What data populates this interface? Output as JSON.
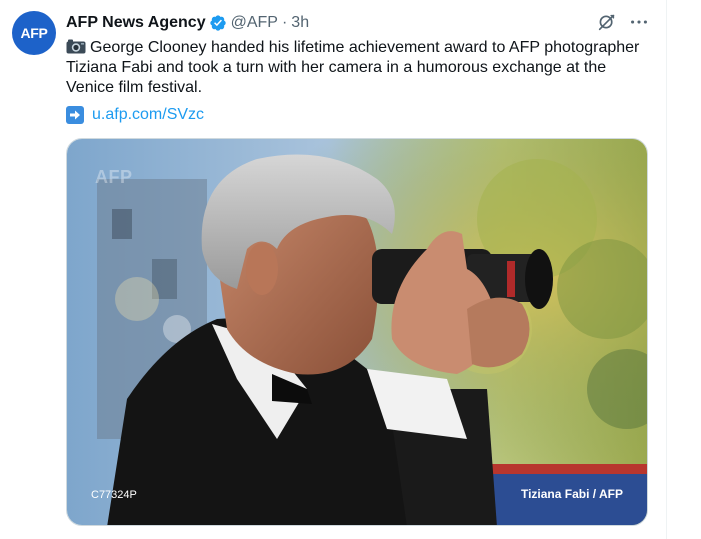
{
  "tweet": {
    "avatar_text": "AFP",
    "author_name": "AFP News Agency",
    "handle": "@AFP",
    "separator": "·",
    "time": "3h",
    "text": "George Clooney handed his lifetime achievement award to AFP photographer Tiziana Fabi and took a turn with her camera in a humorous exchange at the Venice film festival.",
    "link_text": "u.afp.com/SVzc",
    "text_icon": "camera-emoji-icon",
    "link_icon": "right-arrow-emoji-icon"
  },
  "media": {
    "watermark": "AFP",
    "photo_code": "C77324P",
    "credit": "Tiziana Fabi / AFP"
  },
  "colors": {
    "avatar_bg": "#1d62c9",
    "verified": "#1d9bf0",
    "link": "#1d9bf0",
    "muted": "#536471"
  }
}
